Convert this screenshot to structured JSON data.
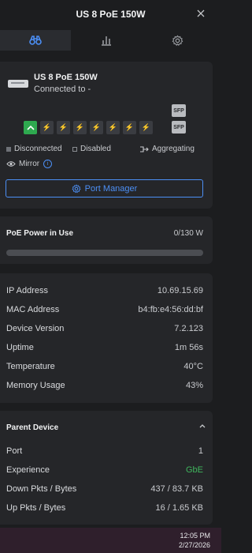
{
  "header": {
    "title": "US 8 PoE 150W"
  },
  "device": {
    "name": "US 8 PoE 150W",
    "connection": "Connected to -"
  },
  "ports": {
    "sfp_label": "SFP"
  },
  "legend": {
    "disconnected": "Disconnected",
    "disabled": "Disabled",
    "aggregating": "Aggregating",
    "mirror": "Mirror"
  },
  "port_manager": {
    "label": "Port Manager"
  },
  "poe": {
    "title": "PoE Power in Use",
    "value": "0/130 W",
    "fraction": 0
  },
  "info": [
    {
      "key": "IP Address",
      "value": "10.69.15.69"
    },
    {
      "key": "MAC Address",
      "value": "b4:fb:e4:56:dd:bf"
    },
    {
      "key": "Device Version",
      "value": "7.2.123"
    },
    {
      "key": "Uptime",
      "value": "1m 56s"
    },
    {
      "key": "Temperature",
      "value": "40°C"
    },
    {
      "key": "Memory Usage",
      "value": "43%"
    }
  ],
  "parent": {
    "title": "Parent Device",
    "rows": [
      {
        "key": "Port",
        "value": "1"
      },
      {
        "key": "Experience",
        "value": "GbE"
      },
      {
        "key": "Down Pkts / Bytes",
        "value": "437 / 83.7 KB"
      },
      {
        "key": "Up Pkts / Bytes",
        "value": "16 / 1.65 KB"
      }
    ]
  },
  "taskbar": {
    "time": "12:05 PM",
    "date": "2/27/2026"
  },
  "colors": {
    "accent": "#4c8ff5",
    "port_up": "#2ea94f",
    "experience": "#3fb55d"
  }
}
